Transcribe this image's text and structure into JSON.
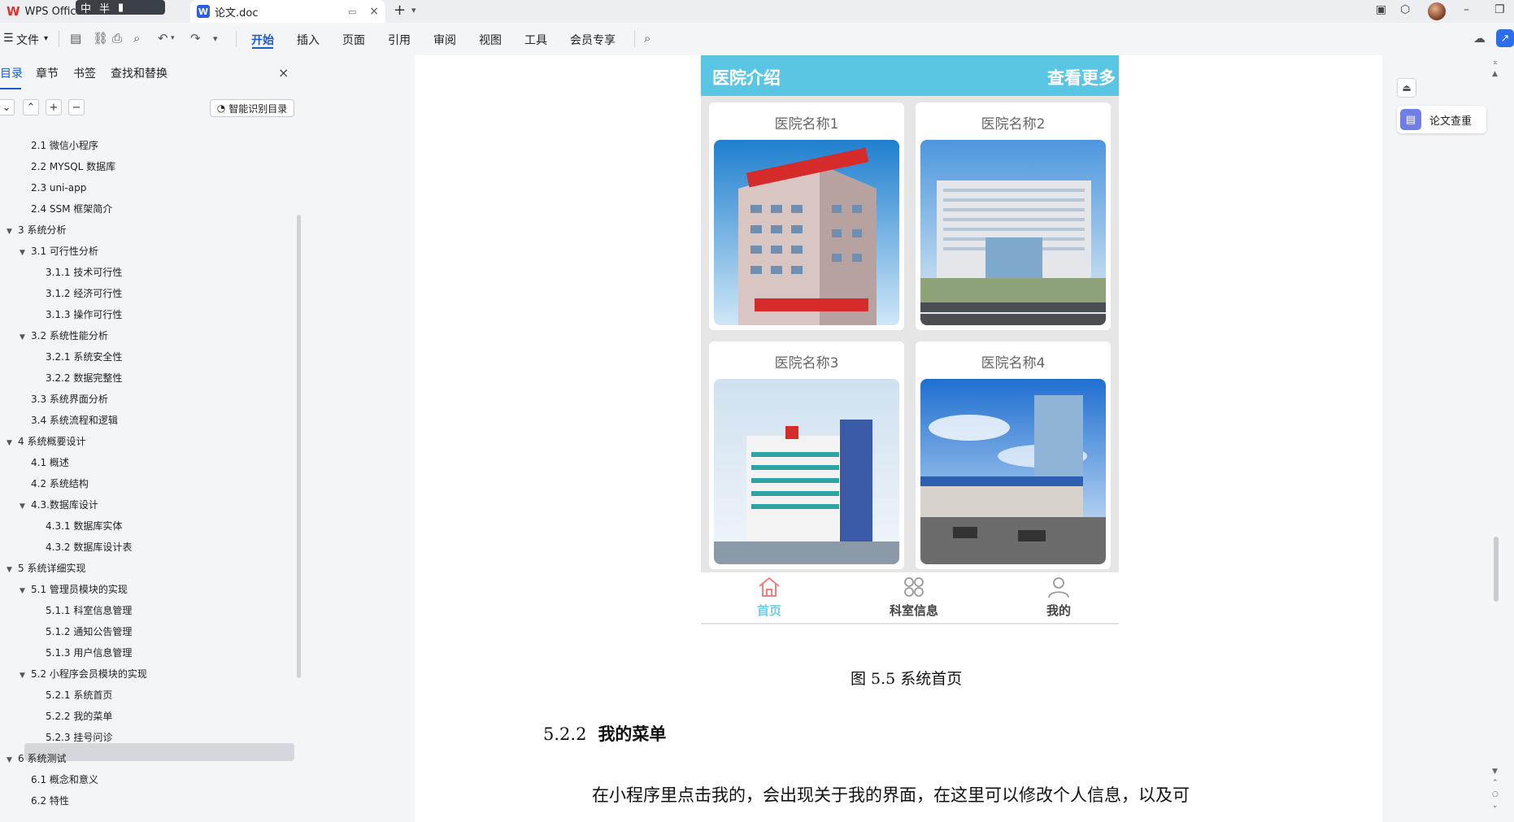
{
  "titlebar": {
    "app_tab": "WPS Office",
    "ime_text1": "中",
    "ime_text2": "半",
    "doc_icon_letter": "W",
    "doc_tab": "论文.doc",
    "close": "×",
    "new_tab": "+"
  },
  "menu": {
    "file": "文件",
    "items": [
      "开始",
      "插入",
      "页面",
      "引用",
      "审阅",
      "视图",
      "工具",
      "会员专享"
    ]
  },
  "sidebar": {
    "tabs": [
      "目录",
      "章节",
      "书签",
      "查找和替换"
    ],
    "close": "×",
    "smart_button": "智能识别目录",
    "toc": [
      {
        "label": "2.1 微信小程序",
        "level": 2
      },
      {
        "label": "2.2 MYSQL 数据库",
        "level": 2
      },
      {
        "label": "2.3 uni-app",
        "level": 2
      },
      {
        "label": "2.4 SSM 框架简介",
        "level": 2
      },
      {
        "label": "3 系统分析",
        "level": 1,
        "arrow": true
      },
      {
        "label": "3.1 可行性分析",
        "level": 2,
        "arrow": true
      },
      {
        "label": "3.1.1 技术可行性",
        "level": 3
      },
      {
        "label": "3.1.2 经济可行性",
        "level": 3
      },
      {
        "label": "3.1.3 操作可行性",
        "level": 3
      },
      {
        "label": "3.2 系统性能分析",
        "level": 2,
        "arrow": true
      },
      {
        "label": "3.2.1  系统安全性",
        "level": 3
      },
      {
        "label": "3.2.2  数据完整性",
        "level": 3
      },
      {
        "label": "3.3 系统界面分析",
        "level": 2
      },
      {
        "label": "3.4 系统流程和逻辑",
        "level": 2
      },
      {
        "label": "4 系统概要设计",
        "level": 1,
        "arrow": true
      },
      {
        "label": "4.1 概述",
        "level": 2
      },
      {
        "label": "4.2 系统结构",
        "level": 2
      },
      {
        "label": "4.3.数据库设计",
        "level": 2,
        "arrow": true
      },
      {
        "label": "4.3.1 数据库实体",
        "level": 3
      },
      {
        "label": "4.3.2 数据库设计表",
        "level": 3
      },
      {
        "label": "5 系统详细实现",
        "level": 1,
        "arrow": true
      },
      {
        "label": "5.1  管理员模块的实现",
        "level": 2,
        "arrow": true
      },
      {
        "label": "5.1.1  科室信息管理",
        "level": 3
      },
      {
        "label": "5.1.2  通知公告管理",
        "level": 3
      },
      {
        "label": "5.1.3  用户信息管理",
        "level": 3
      },
      {
        "label": "5.2  小程序会员模块的实现",
        "level": 2,
        "arrow": true
      },
      {
        "label": "5.2.1  系统首页",
        "level": 3,
        "selected": true
      },
      {
        "label": "5.2.2  我的菜单",
        "level": 3
      },
      {
        "label": "5.2.3  挂号问诊",
        "level": 3
      },
      {
        "label": "6 系统测试",
        "level": 1,
        "arrow": true
      },
      {
        "label": "6.1 概念和意义",
        "level": 2
      },
      {
        "label": "6.2 特性",
        "level": 2
      }
    ]
  },
  "document": {
    "mini_app": {
      "header_left": "医院介绍",
      "header_right": "查看更多",
      "cards": [
        "医院名称1",
        "医院名称2",
        "医院名称3",
        "医院名称4"
      ],
      "nav": [
        "首页",
        "科室信息",
        "我的"
      ]
    },
    "caption": "图 5.5  系统首页",
    "heading_num": "5.2.2",
    "heading_text": "我的菜单",
    "paragraph": "在小程序里点击我的，会出现关于我的界面，在这里可以修改个人信息，以及可"
  },
  "right_panel": {
    "paper_check": "论文查重"
  },
  "colors": {
    "accent": "#1a5ccb",
    "mini_header": "#5bc5e4",
    "nav_active": "#6ad0ea"
  }
}
